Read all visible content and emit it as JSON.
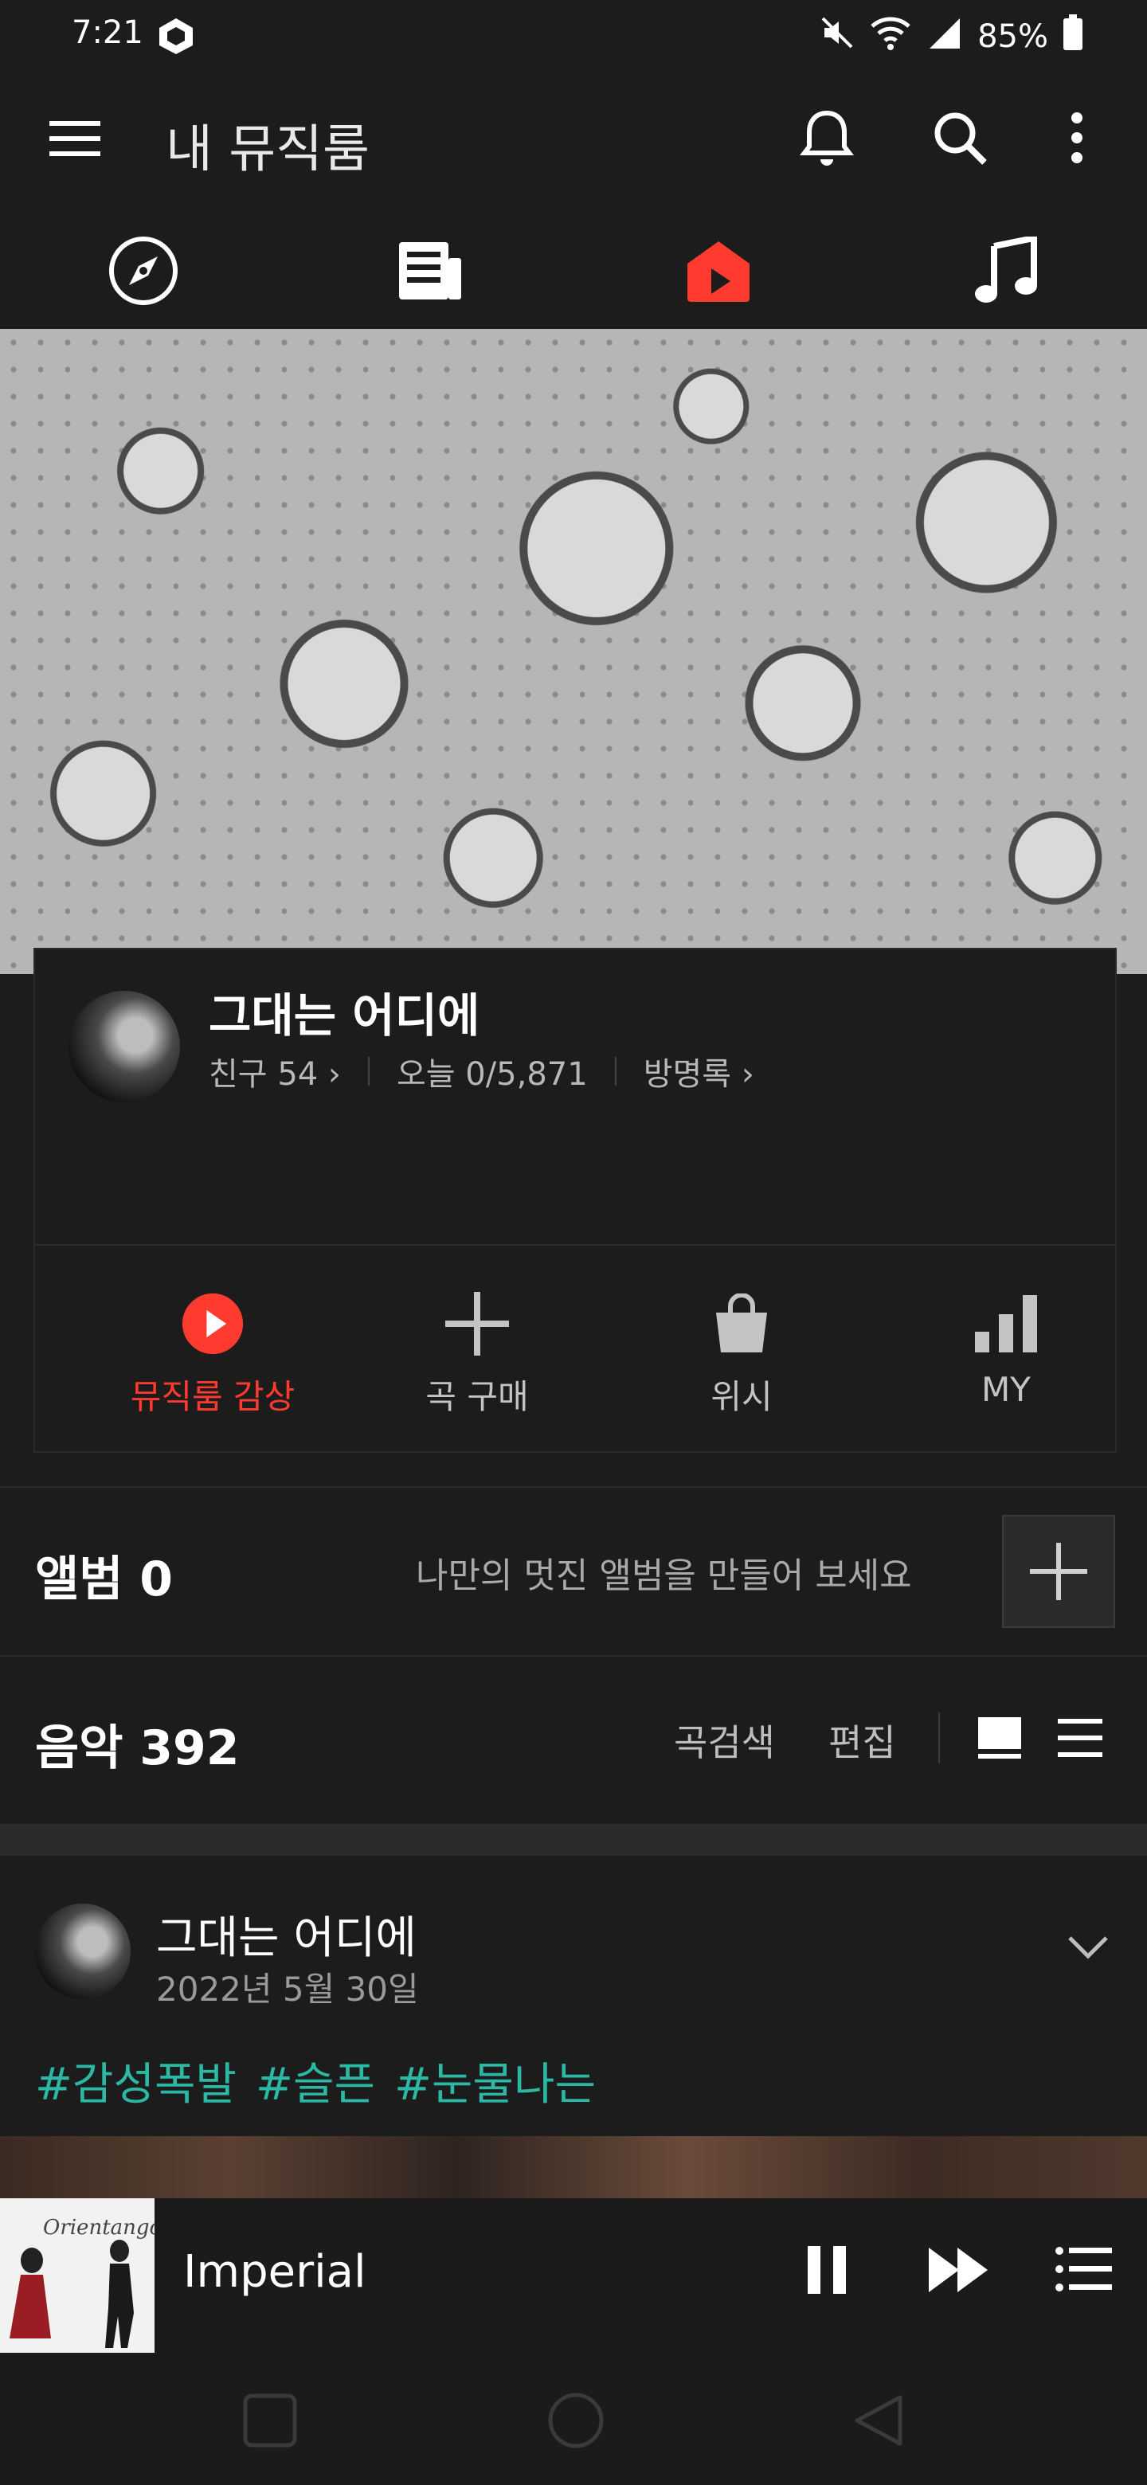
{
  "status": {
    "time": "7:21",
    "battery": "85%"
  },
  "appbar": {
    "title": "내 뮤직룸"
  },
  "tabs": [
    "compass-icon",
    "news-icon",
    "musicroom-play-icon",
    "music-note-icon"
  ],
  "profile": {
    "name": "그대는 어디에",
    "friends": "친구 54",
    "today": "오늘 0/5,871",
    "guestbook": "방명록"
  },
  "actions": [
    {
      "label": "뮤직룸 감상",
      "active": true
    },
    {
      "label": "곡 구매"
    },
    {
      "label": "위시"
    },
    {
      "label": "MY"
    }
  ],
  "album": {
    "title": "앨범 0",
    "hint": "나만의 멋진 앨범을 만들어 보세요"
  },
  "music": {
    "title": "음악 392",
    "search": "곡검색",
    "edit": "편집"
  },
  "post": {
    "name": "그대는 어디에",
    "date": "2022년 5월 30일",
    "tags": [
      "#감성폭발",
      "#슬픈",
      "#눈물나는"
    ]
  },
  "player": {
    "track": "Imperial",
    "album_art_text": "Orientango"
  },
  "colors": {
    "accent": "#ff3b30",
    "tag": "#2bb8a4",
    "background": "#1c1c1c"
  }
}
